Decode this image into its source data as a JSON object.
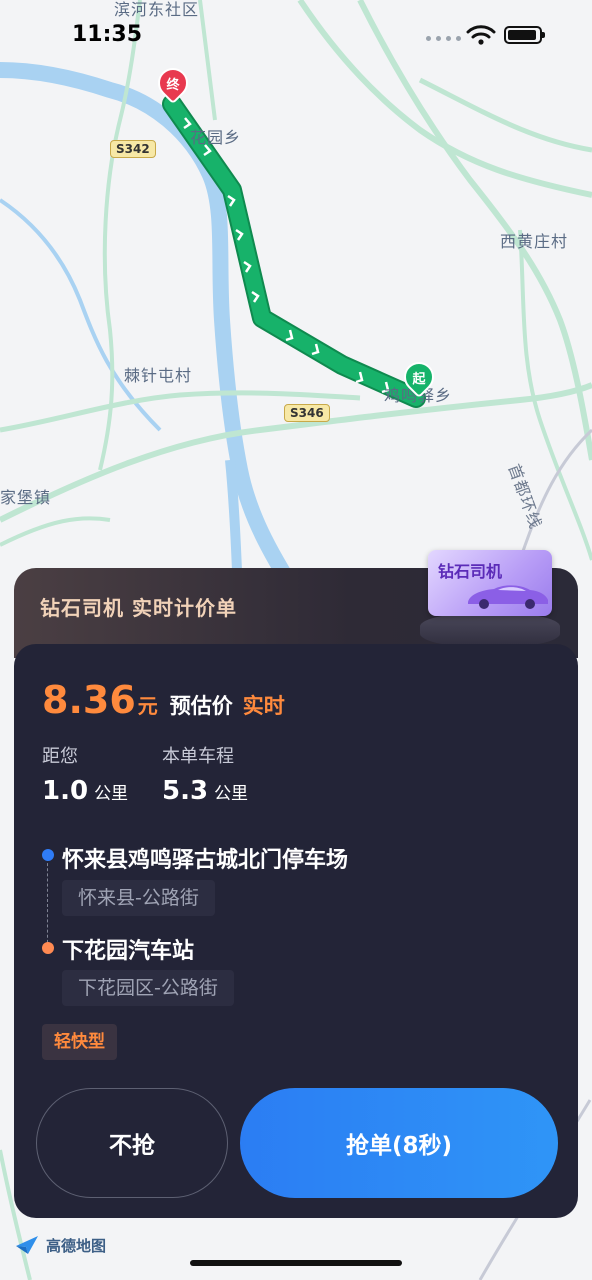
{
  "status_bar": {
    "time": "11:35"
  },
  "map": {
    "labels": {
      "binhe": "滨河东社区",
      "xiahuayuan": "花园乡",
      "xihuangzhuang": "西黄庄村",
      "jizhentun": "棘针屯村",
      "jimingyi": "鸡鸣驿乡",
      "jiabao": "家堡镇",
      "shoudu": "首都环线",
      "s342": "S342",
      "s346": "S346"
    },
    "start_marker": "起",
    "end_marker": "终",
    "colors": {
      "route": "#17b26a",
      "water": "#a9d2f2",
      "road": "#bfe6d2"
    }
  },
  "card": {
    "header_title": "钻石司机 实时计价单",
    "badge_text": "钻石司机",
    "price": "8.36",
    "price_unit": "元",
    "price_estimate": "预估价",
    "price_realtime": "实时",
    "distance_label": "距您",
    "distance_value": "1.0",
    "distance_unit": "公里",
    "trip_label": "本单车程",
    "trip_value": "5.3",
    "trip_unit": "公里",
    "origin_name": "怀来县鸡鸣驿古城北门停车场",
    "origin_area": "怀来县-公路街",
    "dest_name": "下花园汽车站",
    "dest_area": "下花园区-公路街",
    "car_type": "轻快型",
    "skip_label": "不抢",
    "grab_label": "抢单(8秒)"
  },
  "footer": {
    "logo_text": "高德地图"
  },
  "colors": {
    "accent_orange": "#ff8a3d",
    "accent_blue": "#2b7df3",
    "card_bg": "#232437"
  }
}
